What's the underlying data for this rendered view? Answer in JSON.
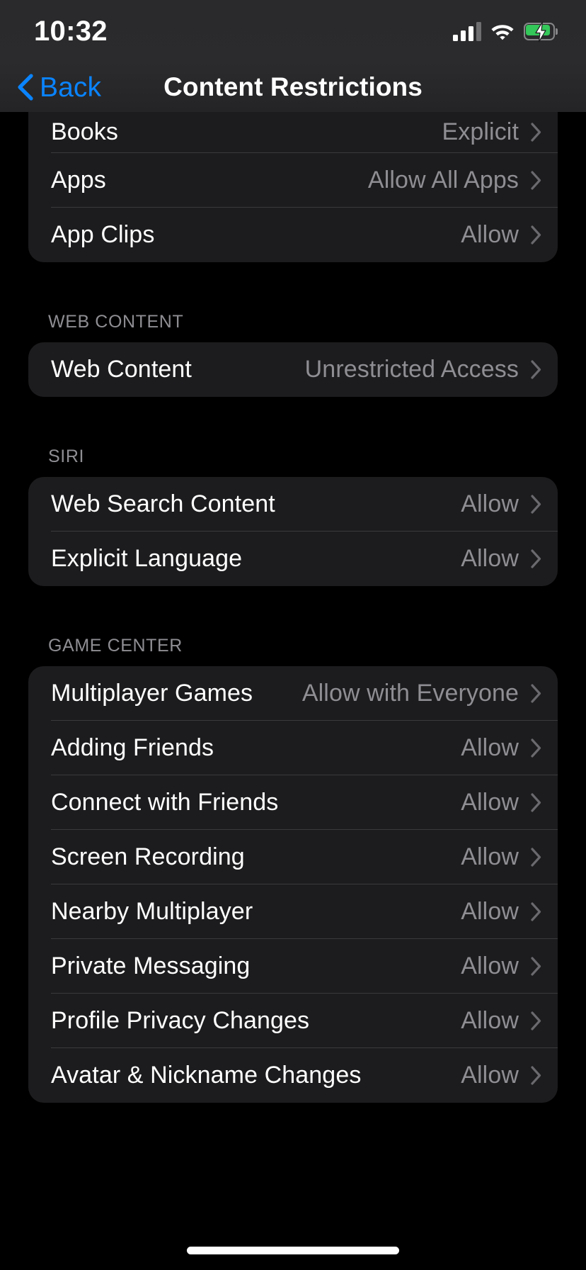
{
  "status_bar": {
    "time": "10:32",
    "signal_icon": "cellular-signal-icon",
    "signal_bars_filled": 3,
    "signal_bars_total": 4,
    "wifi_icon": "wifi-icon",
    "battery_icon": "battery-charging-icon",
    "battery_charging": true,
    "battery_color": "#34C759"
  },
  "nav": {
    "back_label": "Back",
    "back_icon": "chevron-left-icon",
    "title": "Content Restrictions",
    "accent_color": "#0A84FF"
  },
  "colors": {
    "page_background": "#000000",
    "card_background": "#1C1C1E",
    "separator": "#3A3A3C",
    "primary_text": "#FFFFFF",
    "secondary_text": "#8E8E93",
    "accent": "#0A84FF"
  },
  "sections": [
    {
      "header": "",
      "clipped_top": true,
      "rows": [
        {
          "label": "Books",
          "value": "Explicit",
          "chevron": "chevron-right-icon",
          "clipped": true
        },
        {
          "label": "Apps",
          "value": "Allow All Apps",
          "chevron": "chevron-right-icon"
        },
        {
          "label": "App Clips",
          "value": "Allow",
          "chevron": "chevron-right-icon"
        }
      ]
    },
    {
      "header": "WEB CONTENT",
      "rows": [
        {
          "label": "Web Content",
          "value": "Unrestricted Access",
          "chevron": "chevron-right-icon"
        }
      ]
    },
    {
      "header": "SIRI",
      "rows": [
        {
          "label": "Web Search Content",
          "value": "Allow",
          "chevron": "chevron-right-icon"
        },
        {
          "label": "Explicit Language",
          "value": "Allow",
          "chevron": "chevron-right-icon"
        }
      ]
    },
    {
      "header": "GAME CENTER",
      "rows": [
        {
          "label": "Multiplayer Games",
          "value": "Allow with Everyone",
          "chevron": "chevron-right-icon"
        },
        {
          "label": "Adding Friends",
          "value": "Allow",
          "chevron": "chevron-right-icon"
        },
        {
          "label": "Connect with Friends",
          "value": "Allow",
          "chevron": "chevron-right-icon"
        },
        {
          "label": "Screen Recording",
          "value": "Allow",
          "chevron": "chevron-right-icon"
        },
        {
          "label": "Nearby Multiplayer",
          "value": "Allow",
          "chevron": "chevron-right-icon"
        },
        {
          "label": "Private Messaging",
          "value": "Allow",
          "chevron": "chevron-right-icon"
        },
        {
          "label": "Profile Privacy Changes",
          "value": "Allow",
          "chevron": "chevron-right-icon"
        },
        {
          "label": "Avatar & Nickname Changes",
          "value": "Allow",
          "chevron": "chevron-right-icon"
        }
      ]
    }
  ],
  "home_indicator": "home-indicator"
}
